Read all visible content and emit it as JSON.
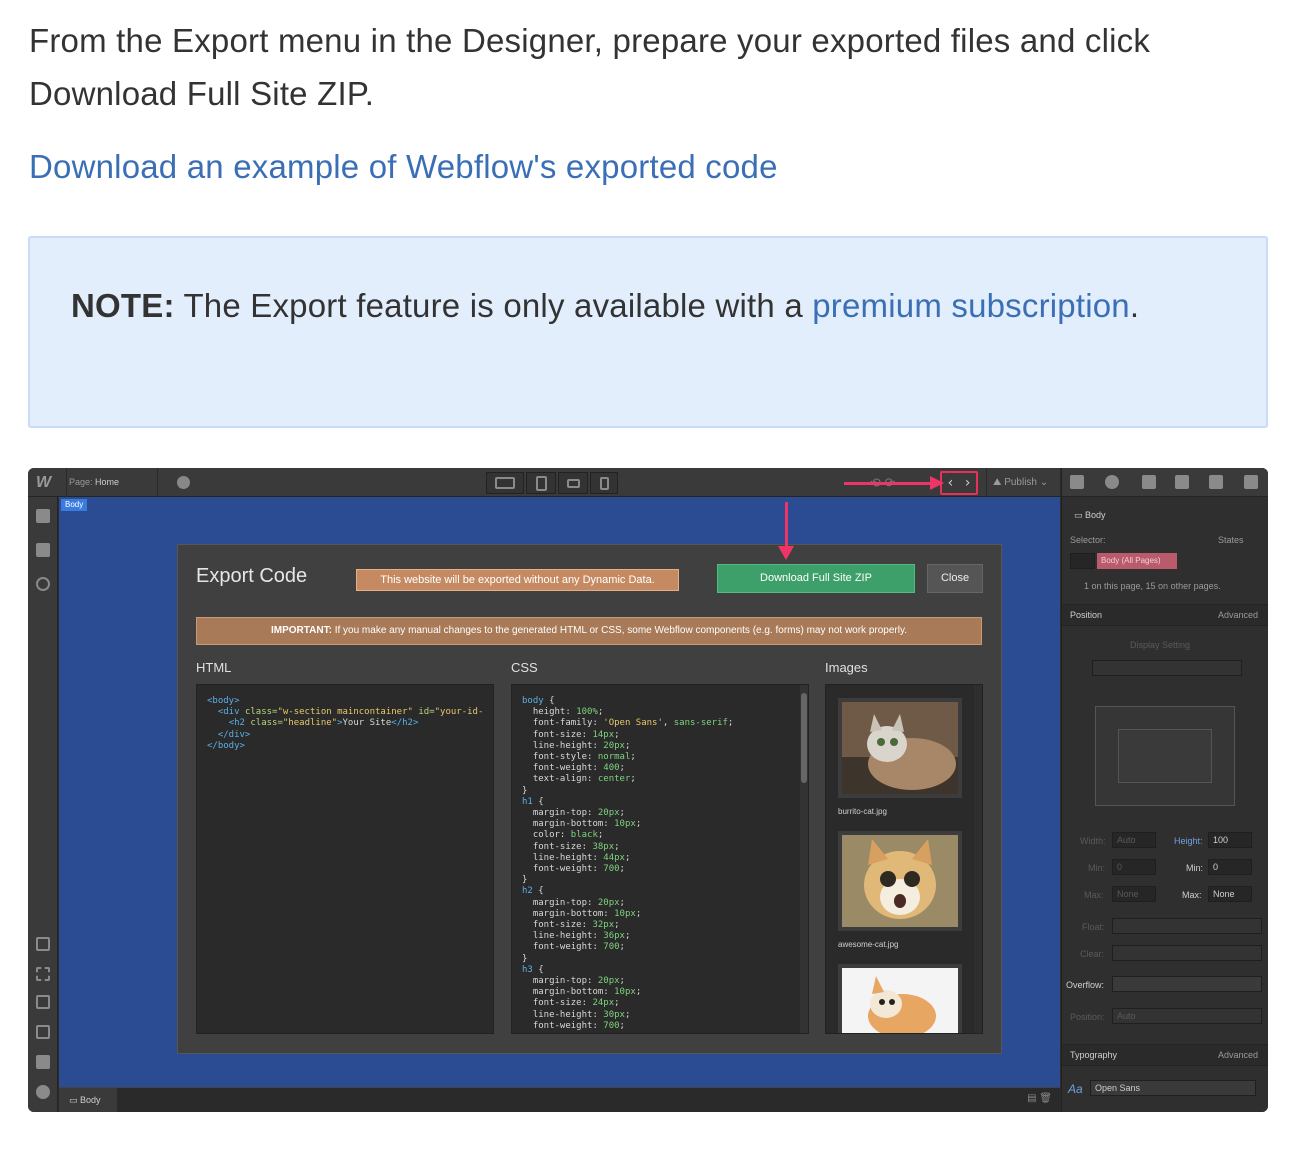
{
  "intro": {
    "text": "From the Export menu in the Designer, prepare your exported files and click Download Full Site ZIP.",
    "link": "Download an example of Webflow's exported code"
  },
  "note": {
    "label": "NOTE:",
    "text": " The Export feature is only available with a ",
    "link": "premium subscription",
    "end": "."
  },
  "designer": {
    "logo": "W",
    "page_label": "Page:",
    "page_value": "Home",
    "body_tag": "Body",
    "code_icon": "‹ ›",
    "publish": "Publish",
    "modal": {
      "title": "Export Code",
      "dynamic_warning": "This website will be exported without any Dynamic Data.",
      "download_button": "Download Full Site ZIP",
      "close_button": "Close",
      "important_label": "IMPORTANT:",
      "important_text": " If you make any manual changes to the generated HTML or CSS, some Webflow components (e.g. forms) may not work properly.",
      "html_label": "HTML",
      "css_label": "CSS",
      "images_label": "Images",
      "images": [
        {
          "name": "burrito-cat.jpg"
        },
        {
          "name": "awesome-cat.jpg"
        },
        {
          "name": ""
        }
      ]
    },
    "breadcrumb": "Body",
    "panel": {
      "element": "Body",
      "selector_label": "Selector:",
      "states_label": "States",
      "selector_chip": "Body (All Pages)",
      "usage_text": "1 on this page, 15 on other pages.",
      "position_label": "Position",
      "advanced_label": "Advanced",
      "display_setting": "Display Setting",
      "width_label": "Width:",
      "width_value": "Auto",
      "height_label": "Height:",
      "height_value": "100",
      "min_label": "Min:",
      "min_value": "0",
      "max_label": "Max:",
      "max_value": "None",
      "float_label": "Float:",
      "clear_label": "Clear:",
      "overflow_label": "Overflow:",
      "position_field_label": "Position:",
      "position_value": "Auto",
      "typography_label": "Typography",
      "font_value": "Open Sans"
    }
  },
  "colors": {
    "link": "#3a6fb6",
    "note_bg": "#e3eefd",
    "accent_pink": "#ee3666",
    "download_green": "#3da06a",
    "canvas_blue": "#2b4c92"
  }
}
